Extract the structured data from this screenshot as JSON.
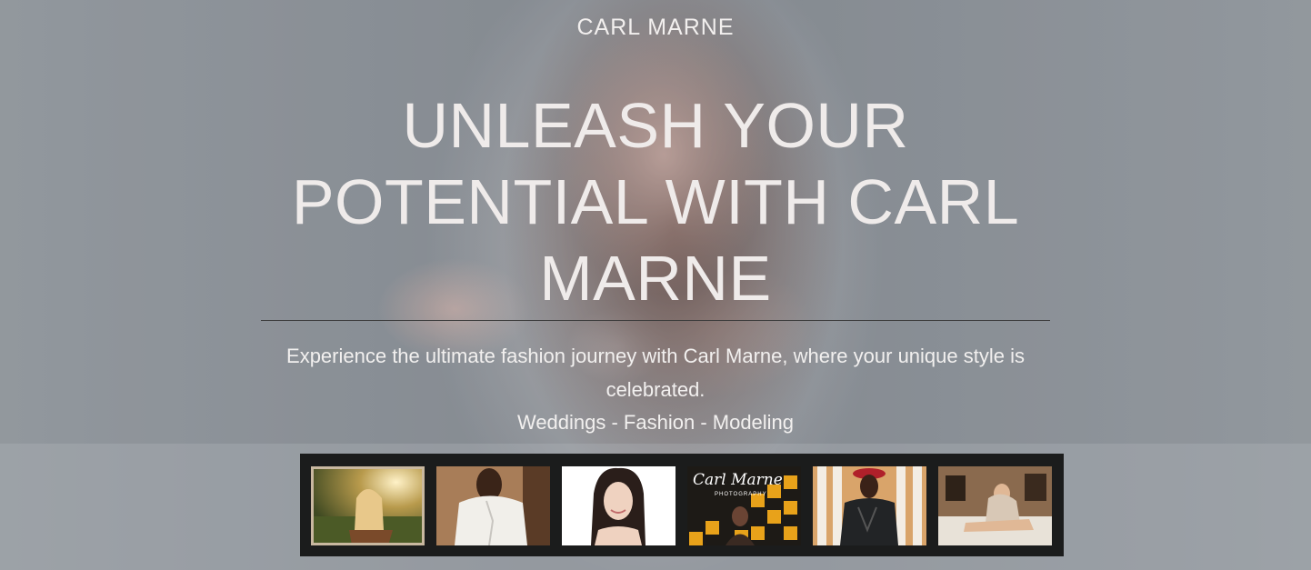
{
  "brand": "CARL MARNE",
  "hero": {
    "headline": "UNLEASH YOUR POTENTIAL WITH CARL MARNE",
    "tagline": "Experience the ultimate fashion journey with Carl Marne, where your unique style is celebrated.",
    "services": "Weddings - Fashion - Modeling"
  },
  "gallery": {
    "thumbnails": [
      {
        "name": "gallery-thumb-1"
      },
      {
        "name": "gallery-thumb-2"
      },
      {
        "name": "gallery-thumb-3"
      },
      {
        "name": "gallery-thumb-4",
        "logo_text": "Carl Marne",
        "logo_subtext": "PHOTOGRAPHY"
      },
      {
        "name": "gallery-thumb-5"
      },
      {
        "name": "gallery-thumb-6"
      }
    ]
  },
  "colors": {
    "text": "#efebea",
    "divider": "#3b3b3b",
    "gallery_bg": "#1b1c1c",
    "accent_yellow": "#e8a21a"
  }
}
